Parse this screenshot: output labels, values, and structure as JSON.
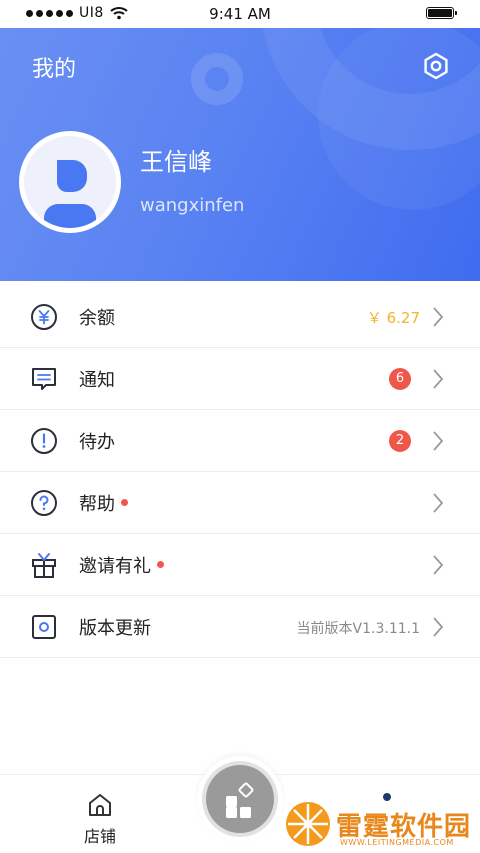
{
  "status_bar": {
    "carrier": "UI8",
    "time": "9:41 AM"
  },
  "header": {
    "title": "我的",
    "user_name": "王信峰",
    "user_id": "wangxinfen"
  },
  "menu": [
    {
      "label": "余额",
      "icon": "yuan-coin-icon",
      "value": "￥ 6.27",
      "value_color": "#f1b42c"
    },
    {
      "label": "通知",
      "icon": "message-icon",
      "badge": "6"
    },
    {
      "label": "待办",
      "icon": "exclamation-circle-icon",
      "badge": "2"
    },
    {
      "label": "帮助",
      "icon": "question-circle-icon",
      "dot": true
    },
    {
      "label": "邀请有礼",
      "icon": "gift-icon",
      "dot": true
    },
    {
      "label": "版本更新",
      "icon": "version-box-icon",
      "value": "当前版本V1.3.11.1"
    }
  ],
  "tabbar": {
    "home_label": "店铺"
  },
  "watermark": {
    "text": "雷霆软件园",
    "sub": "WWW.LEITINGMEDIA.COM"
  },
  "colors": {
    "accent": "#4a78f2",
    "badge": "#f0574b",
    "balance": "#f1b42c"
  }
}
